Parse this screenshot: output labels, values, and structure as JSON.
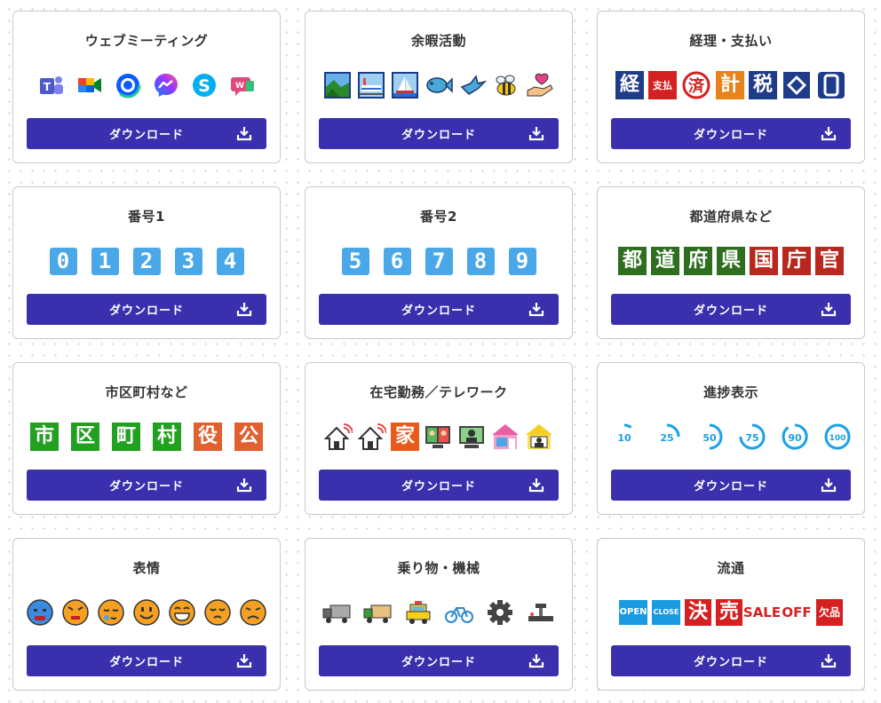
{
  "download_label": "ダウンロード",
  "cards": [
    {
      "title": "ウェブミーティング",
      "icons": [
        "teams-icon",
        "google-meet-icon",
        "zoom-icon",
        "messenger-icon",
        "skype-icon",
        "webex-icon"
      ]
    },
    {
      "title": "余暇活動",
      "icons": [
        "landscape-icon",
        "train-icon",
        "sailboat-icon",
        "fish-icon",
        "bird-icon",
        "bee-icon",
        "heart-hand-icon"
      ]
    },
    {
      "title": "経理・支払い",
      "icons": [
        "経",
        "支払",
        "済",
        "計",
        "税",
        "yen-sign-icon",
        "card-icon"
      ]
    },
    {
      "title": "番号1",
      "icons": [
        "0",
        "1",
        "2",
        "3",
        "4"
      ]
    },
    {
      "title": "番号2",
      "icons": [
        "5",
        "6",
        "7",
        "8",
        "9"
      ]
    },
    {
      "title": "都道府県など",
      "icons": [
        "都",
        "道",
        "府",
        "県",
        "国",
        "庁",
        "官"
      ]
    },
    {
      "title": "市区町村など",
      "icons": [
        "市",
        "区",
        "町",
        "村",
        "役",
        "公"
      ]
    },
    {
      "title": "在宅勤務／テレワーク",
      "icons": [
        "home-wifi-icon",
        "home-wifi-icon",
        "家",
        "video-call-icon",
        "monitor-user-icon",
        "house-meeting-icon",
        "house-user-icon"
      ]
    },
    {
      "title": "進捗表示",
      "icons": [
        "10",
        "25",
        "50",
        "75",
        "90",
        "100"
      ]
    },
    {
      "title": "表情",
      "icons": [
        "crying-face-icon",
        "angry-face-icon",
        "sleepy-face-icon",
        "smile-face-icon",
        "grin-face-icon",
        "pout-face-icon",
        "frown-face-icon"
      ]
    },
    {
      "title": "乗り物・機械",
      "icons": [
        "truck-icon",
        "truck-icon",
        "taxi-icon",
        "bicycle-icon",
        "gear-icon",
        "machine-icon"
      ]
    },
    {
      "title": "流通",
      "icons": [
        "OPEN",
        "CLOSE",
        "決",
        "売",
        "SALE",
        "OFF",
        "欠品"
      ]
    }
  ],
  "colors": {
    "button": "#3a2fad",
    "digit_bg": "#4aa8e8",
    "accounting_navy": "#1f3c8a",
    "accounting_red": "#d42020",
    "accounting_orange": "#e8821a",
    "prefecture_green": "#2e6e1e",
    "prefecture_red": "#b8281e",
    "municipal_green": "#22a020",
    "municipal_orange": "#e06030",
    "progress_blue": "#1aa0e8",
    "sale_red": "#d42020",
    "open_blue": "#1a9ae0"
  }
}
